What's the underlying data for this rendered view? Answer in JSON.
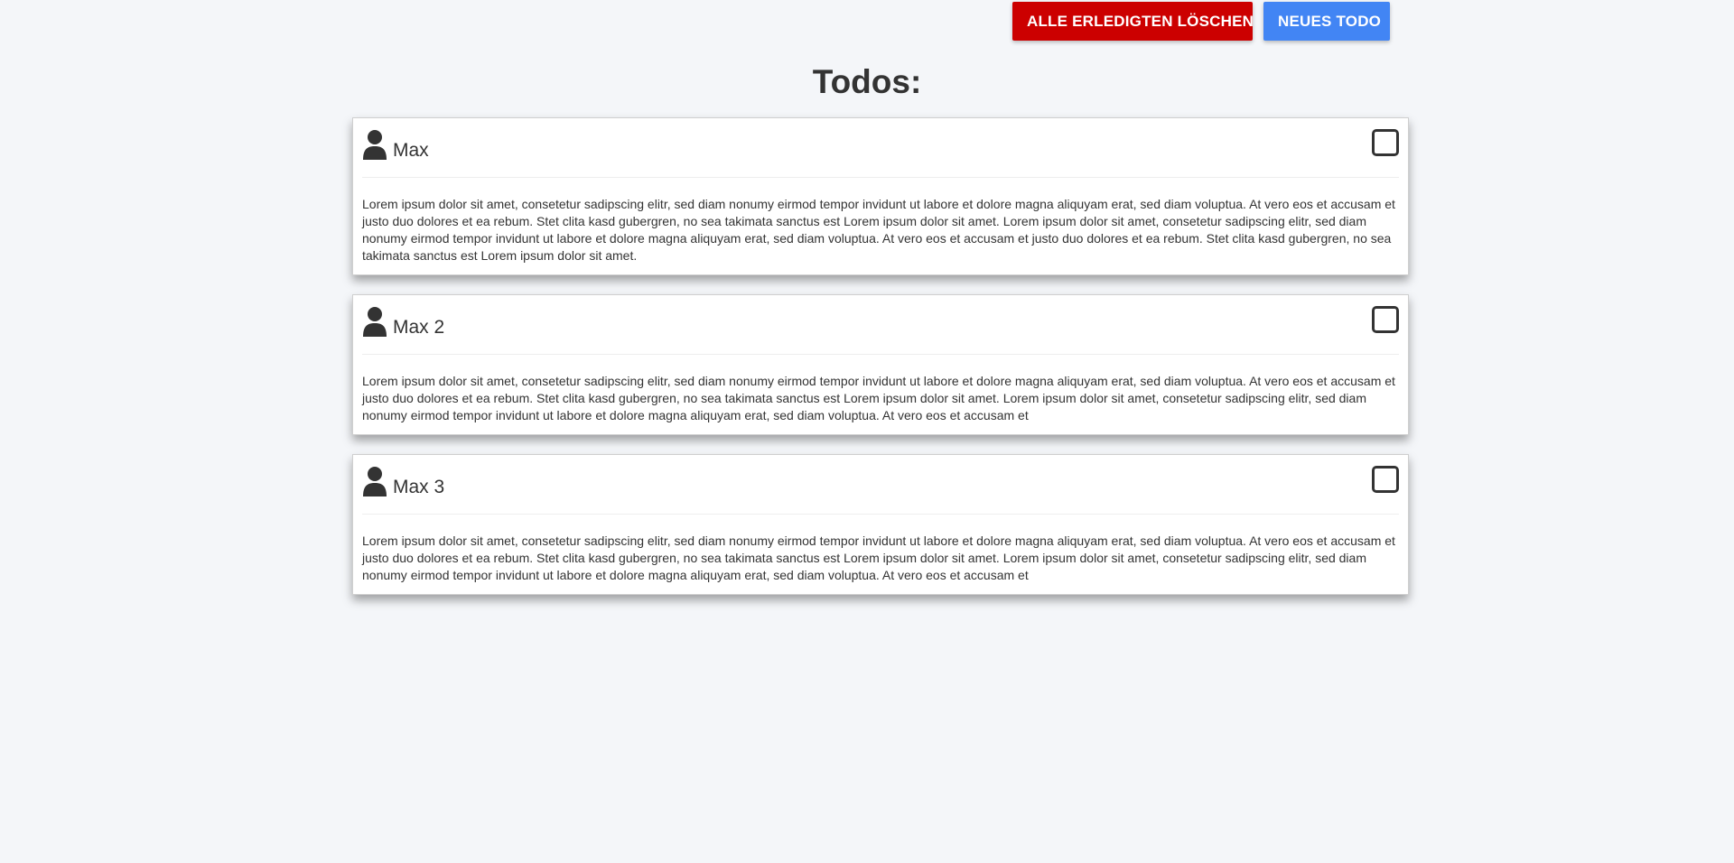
{
  "toolbar": {
    "delete_done_label": "ALLE ERLEDIGTEN LÖSCHEN",
    "new_todo_label": "NEUES TODO"
  },
  "page_title": "Todos:",
  "todos": [
    {
      "user": "Max",
      "done": false,
      "text": "Lorem ipsum dolor sit amet, consetetur sadipscing elitr, sed diam nonumy eirmod tempor invidunt ut labore et dolore magna aliquyam erat, sed diam voluptua. At vero eos et accusam et justo duo dolores et ea rebum. Stet clita kasd gubergren, no sea takimata sanctus est Lorem ipsum dolor sit amet. Lorem ipsum dolor sit amet, consetetur sadipscing elitr, sed diam nonumy eirmod tempor invidunt ut labore et dolore magna aliquyam erat, sed diam voluptua. At vero eos et accusam et justo duo dolores et ea rebum. Stet clita kasd gubergren, no sea takimata sanctus est Lorem ipsum dolor sit amet."
    },
    {
      "user": "Max 2",
      "done": false,
      "text": "Lorem ipsum dolor sit amet, consetetur sadipscing elitr, sed diam nonumy eirmod tempor invidunt ut labore et dolore magna aliquyam erat, sed diam voluptua. At vero eos et accusam et justo duo dolores et ea rebum. Stet clita kasd gubergren, no sea takimata sanctus est Lorem ipsum dolor sit amet. Lorem ipsum dolor sit amet, consetetur sadipscing elitr, sed diam nonumy eirmod tempor invidunt ut labore et dolore magna aliquyam erat, sed diam voluptua. At vero eos et accusam et"
    },
    {
      "user": "Max 3",
      "done": false,
      "text": "Lorem ipsum dolor sit amet, consetetur sadipscing elitr, sed diam nonumy eirmod tempor invidunt ut labore et dolore magna aliquyam erat, sed diam voluptua. At vero eos et accusam et justo duo dolores et ea rebum. Stet clita kasd gubergren, no sea takimata sanctus est Lorem ipsum dolor sit amet. Lorem ipsum dolor sit amet, consetetur sadipscing elitr, sed diam nonumy eirmod tempor invidunt ut labore et dolore magna aliquyam erat, sed diam voluptua. At vero eos et accusam et"
    }
  ],
  "icons": {
    "user": "user-icon",
    "checkbox": "checkbox-unchecked"
  },
  "colors": {
    "danger": "#cc0000",
    "primary": "#4285f4",
    "background": "#f4f6f9",
    "text": "#333333"
  }
}
